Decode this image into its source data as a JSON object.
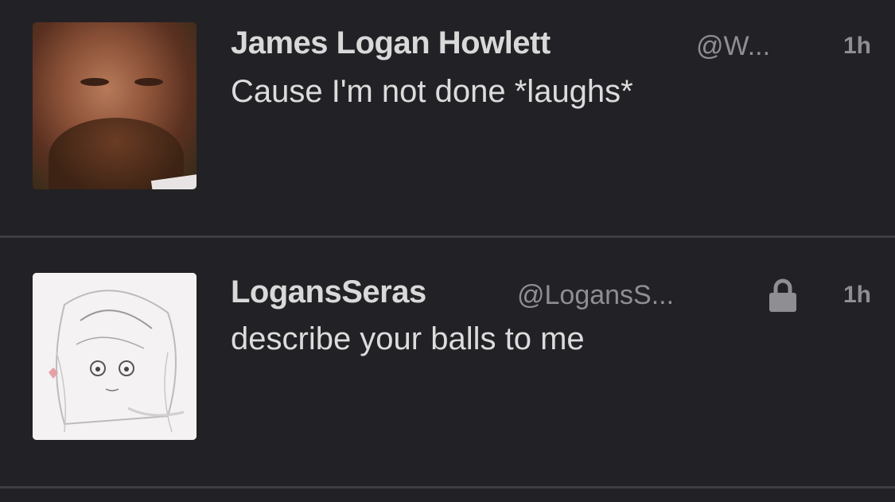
{
  "tweets": [
    {
      "name": "James Logan Howlett",
      "handle": "@W...",
      "time": "1h",
      "text": "Cause I'm not done *laughs*",
      "locked": false,
      "avatar_icon": "user-photo-icon"
    },
    {
      "name": "LogansSeras",
      "handle": "@LogansS...",
      "time": "1h",
      "text": "describe your balls to me",
      "locked": true,
      "avatar_icon": "user-sketch-icon",
      "lock_icon": "lock-icon"
    }
  ],
  "colors": {
    "background": "#222226",
    "divider": "#3d3d42",
    "name": "#d9d9d9",
    "meta": "#8e8e93",
    "text": "#dcdcdc"
  }
}
